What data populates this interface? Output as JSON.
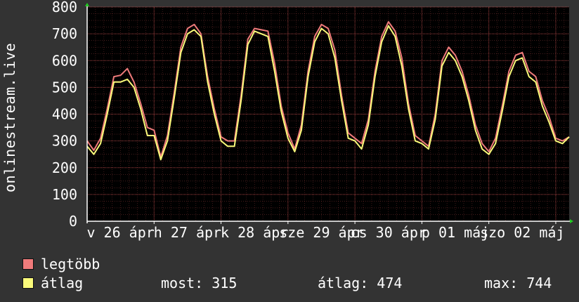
{
  "chart_data": {
    "type": "line",
    "ylabel": "onlinestream.live",
    "ylim": [
      0,
      800
    ],
    "yticks": [
      0,
      100,
      200,
      300,
      400,
      500,
      600,
      700,
      800
    ],
    "xticks": [
      "v 26 ápr",
      "h 27 ápr",
      "k 28 ápr",
      "sze 29 ápr",
      "cs 30 ápr",
      "p 01 máj",
      "szo 02 máj"
    ],
    "x_range_days": [
      0,
      7.2
    ],
    "grid": true,
    "colors": {
      "legtobb": "#f07b7b",
      "atlag": "#fafa7a",
      "grid": "#c85050",
      "axis": "#ffffff",
      "arrow": "#22cc22"
    },
    "series": [
      {
        "name": "legtöbb",
        "x": [
          0,
          0.1,
          0.2,
          0.3,
          0.4,
          0.5,
          0.6,
          0.7,
          0.8,
          0.9,
          1.0,
          1.1,
          1.2,
          1.3,
          1.4,
          1.5,
          1.6,
          1.7,
          1.8,
          1.9,
          2.0,
          2.1,
          2.2,
          2.3,
          2.4,
          2.5,
          2.6,
          2.7,
          2.8,
          2.9,
          3.0,
          3.1,
          3.2,
          3.3,
          3.4,
          3.5,
          3.6,
          3.7,
          3.8,
          3.9,
          4.0,
          4.1,
          4.2,
          4.3,
          4.4,
          4.5,
          4.6,
          4.7,
          4.8,
          4.9,
          5.0,
          5.1,
          5.2,
          5.3,
          5.4,
          5.5,
          5.6,
          5.7,
          5.8,
          5.9,
          6.0,
          6.1,
          6.2,
          6.3,
          6.4,
          6.5,
          6.6,
          6.7,
          6.8,
          6.9,
          7.0,
          7.1,
          7.2
        ],
        "values": [
          300,
          265,
          310,
          420,
          540,
          545,
          570,
          520,
          440,
          350,
          340,
          240,
          320,
          480,
          650,
          720,
          735,
          700,
          540,
          420,
          315,
          300,
          300,
          470,
          680,
          720,
          715,
          710,
          590,
          430,
          330,
          270,
          360,
          560,
          690,
          735,
          720,
          640,
          470,
          330,
          310,
          290,
          380,
          560,
          690,
          745,
          710,
          610,
          440,
          320,
          300,
          280,
          400,
          600,
          650,
          620,
          560,
          470,
          360,
          290,
          260,
          310,
          430,
          560,
          620,
          630,
          560,
          540,
          450,
          390,
          310,
          300,
          315
        ]
      },
      {
        "name": "átlag",
        "x": [
          0,
          0.1,
          0.2,
          0.3,
          0.4,
          0.5,
          0.6,
          0.7,
          0.8,
          0.9,
          1.0,
          1.1,
          1.2,
          1.3,
          1.4,
          1.5,
          1.6,
          1.7,
          1.8,
          1.9,
          2.0,
          2.1,
          2.2,
          2.3,
          2.4,
          2.5,
          2.6,
          2.7,
          2.8,
          2.9,
          3.0,
          3.1,
          3.2,
          3.3,
          3.4,
          3.5,
          3.6,
          3.7,
          3.8,
          3.9,
          4.0,
          4.1,
          4.2,
          4.3,
          4.4,
          4.5,
          4.6,
          4.7,
          4.8,
          4.9,
          5.0,
          5.1,
          5.2,
          5.3,
          5.4,
          5.5,
          5.6,
          5.7,
          5.8,
          5.9,
          6.0,
          6.1,
          6.2,
          6.3,
          6.4,
          6.5,
          6.6,
          6.7,
          6.8,
          6.9,
          7.0,
          7.1,
          7.2
        ],
        "values": [
          280,
          250,
          290,
          400,
          520,
          520,
          530,
          500,
          420,
          320,
          320,
          230,
          300,
          460,
          630,
          700,
          715,
          690,
          520,
          400,
          300,
          280,
          280,
          450,
          660,
          710,
          700,
          690,
          560,
          410,
          310,
          260,
          340,
          540,
          670,
          720,
          700,
          610,
          450,
          310,
          300,
          270,
          360,
          540,
          670,
          730,
          690,
          580,
          420,
          300,
          290,
          270,
          380,
          580,
          630,
          600,
          540,
          450,
          340,
          270,
          250,
          290,
          410,
          540,
          600,
          610,
          540,
          520,
          430,
          370,
          300,
          290,
          315
        ]
      }
    ]
  },
  "legend": {
    "items": [
      {
        "label": "legtöbb",
        "color": "#f07b7b"
      },
      {
        "label": "átlag",
        "color": "#fafa7a"
      }
    ]
  },
  "stats": {
    "now": "most: 315",
    "avg": "átlag: 474",
    "max": "max: 744"
  }
}
